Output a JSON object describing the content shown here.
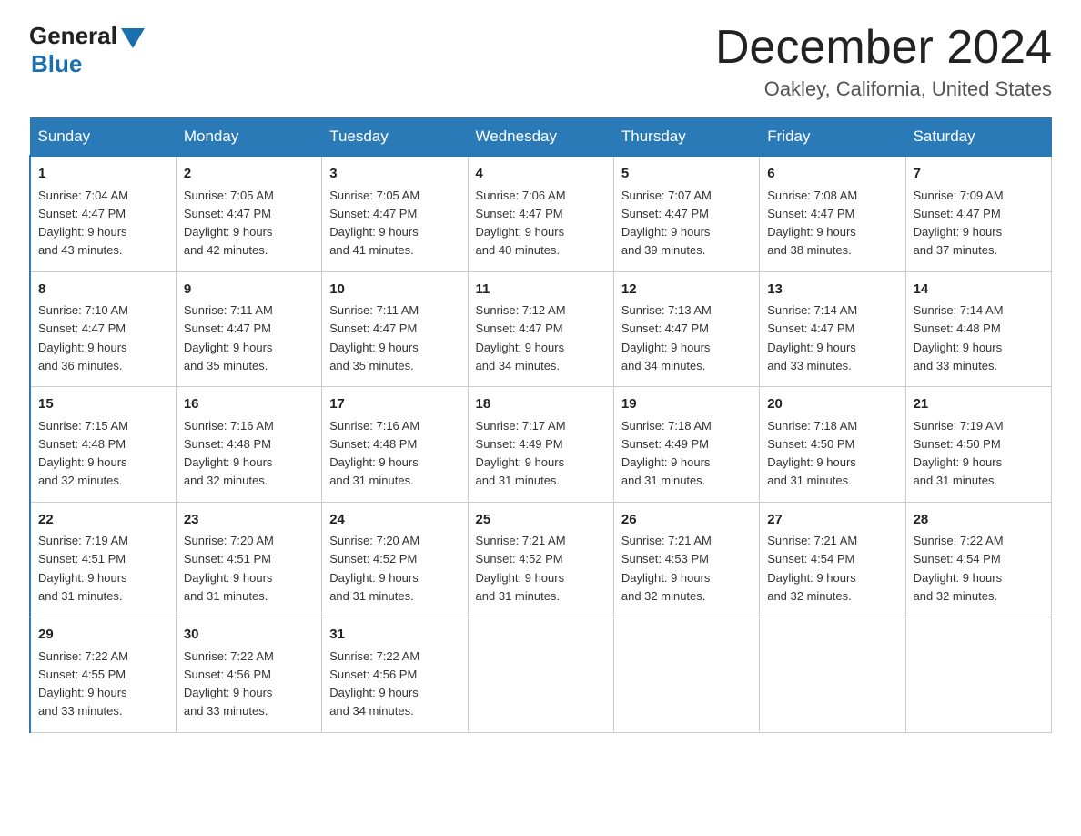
{
  "logo": {
    "general": "General",
    "blue": "Blue"
  },
  "title": "December 2024",
  "subtitle": "Oakley, California, United States",
  "days_of_week": [
    "Sunday",
    "Monday",
    "Tuesday",
    "Wednesday",
    "Thursday",
    "Friday",
    "Saturday"
  ],
  "weeks": [
    [
      {
        "day": "1",
        "sunrise": "7:04 AM",
        "sunset": "4:47 PM",
        "daylight": "9 hours and 43 minutes."
      },
      {
        "day": "2",
        "sunrise": "7:05 AM",
        "sunset": "4:47 PM",
        "daylight": "9 hours and 42 minutes."
      },
      {
        "day": "3",
        "sunrise": "7:05 AM",
        "sunset": "4:47 PM",
        "daylight": "9 hours and 41 minutes."
      },
      {
        "day": "4",
        "sunrise": "7:06 AM",
        "sunset": "4:47 PM",
        "daylight": "9 hours and 40 minutes."
      },
      {
        "day": "5",
        "sunrise": "7:07 AM",
        "sunset": "4:47 PM",
        "daylight": "9 hours and 39 minutes."
      },
      {
        "day": "6",
        "sunrise": "7:08 AM",
        "sunset": "4:47 PM",
        "daylight": "9 hours and 38 minutes."
      },
      {
        "day": "7",
        "sunrise": "7:09 AM",
        "sunset": "4:47 PM",
        "daylight": "9 hours and 37 minutes."
      }
    ],
    [
      {
        "day": "8",
        "sunrise": "7:10 AM",
        "sunset": "4:47 PM",
        "daylight": "9 hours and 36 minutes."
      },
      {
        "day": "9",
        "sunrise": "7:11 AM",
        "sunset": "4:47 PM",
        "daylight": "9 hours and 35 minutes."
      },
      {
        "day": "10",
        "sunrise": "7:11 AM",
        "sunset": "4:47 PM",
        "daylight": "9 hours and 35 minutes."
      },
      {
        "day": "11",
        "sunrise": "7:12 AM",
        "sunset": "4:47 PM",
        "daylight": "9 hours and 34 minutes."
      },
      {
        "day": "12",
        "sunrise": "7:13 AM",
        "sunset": "4:47 PM",
        "daylight": "9 hours and 34 minutes."
      },
      {
        "day": "13",
        "sunrise": "7:14 AM",
        "sunset": "4:47 PM",
        "daylight": "9 hours and 33 minutes."
      },
      {
        "day": "14",
        "sunrise": "7:14 AM",
        "sunset": "4:48 PM",
        "daylight": "9 hours and 33 minutes."
      }
    ],
    [
      {
        "day": "15",
        "sunrise": "7:15 AM",
        "sunset": "4:48 PM",
        "daylight": "9 hours and 32 minutes."
      },
      {
        "day": "16",
        "sunrise": "7:16 AM",
        "sunset": "4:48 PM",
        "daylight": "9 hours and 32 minutes."
      },
      {
        "day": "17",
        "sunrise": "7:16 AM",
        "sunset": "4:48 PM",
        "daylight": "9 hours and 31 minutes."
      },
      {
        "day": "18",
        "sunrise": "7:17 AM",
        "sunset": "4:49 PM",
        "daylight": "9 hours and 31 minutes."
      },
      {
        "day": "19",
        "sunrise": "7:18 AM",
        "sunset": "4:49 PM",
        "daylight": "9 hours and 31 minutes."
      },
      {
        "day": "20",
        "sunrise": "7:18 AM",
        "sunset": "4:50 PM",
        "daylight": "9 hours and 31 minutes."
      },
      {
        "day": "21",
        "sunrise": "7:19 AM",
        "sunset": "4:50 PM",
        "daylight": "9 hours and 31 minutes."
      }
    ],
    [
      {
        "day": "22",
        "sunrise": "7:19 AM",
        "sunset": "4:51 PM",
        "daylight": "9 hours and 31 minutes."
      },
      {
        "day": "23",
        "sunrise": "7:20 AM",
        "sunset": "4:51 PM",
        "daylight": "9 hours and 31 minutes."
      },
      {
        "day": "24",
        "sunrise": "7:20 AM",
        "sunset": "4:52 PM",
        "daylight": "9 hours and 31 minutes."
      },
      {
        "day": "25",
        "sunrise": "7:21 AM",
        "sunset": "4:52 PM",
        "daylight": "9 hours and 31 minutes."
      },
      {
        "day": "26",
        "sunrise": "7:21 AM",
        "sunset": "4:53 PM",
        "daylight": "9 hours and 32 minutes."
      },
      {
        "day": "27",
        "sunrise": "7:21 AM",
        "sunset": "4:54 PM",
        "daylight": "9 hours and 32 minutes."
      },
      {
        "day": "28",
        "sunrise": "7:22 AM",
        "sunset": "4:54 PM",
        "daylight": "9 hours and 32 minutes."
      }
    ],
    [
      {
        "day": "29",
        "sunrise": "7:22 AM",
        "sunset": "4:55 PM",
        "daylight": "9 hours and 33 minutes."
      },
      {
        "day": "30",
        "sunrise": "7:22 AM",
        "sunset": "4:56 PM",
        "daylight": "9 hours and 33 minutes."
      },
      {
        "day": "31",
        "sunrise": "7:22 AM",
        "sunset": "4:56 PM",
        "daylight": "9 hours and 34 minutes."
      },
      null,
      null,
      null,
      null
    ]
  ],
  "labels": {
    "sunrise": "Sunrise:",
    "sunset": "Sunset:",
    "daylight": "Daylight:"
  }
}
